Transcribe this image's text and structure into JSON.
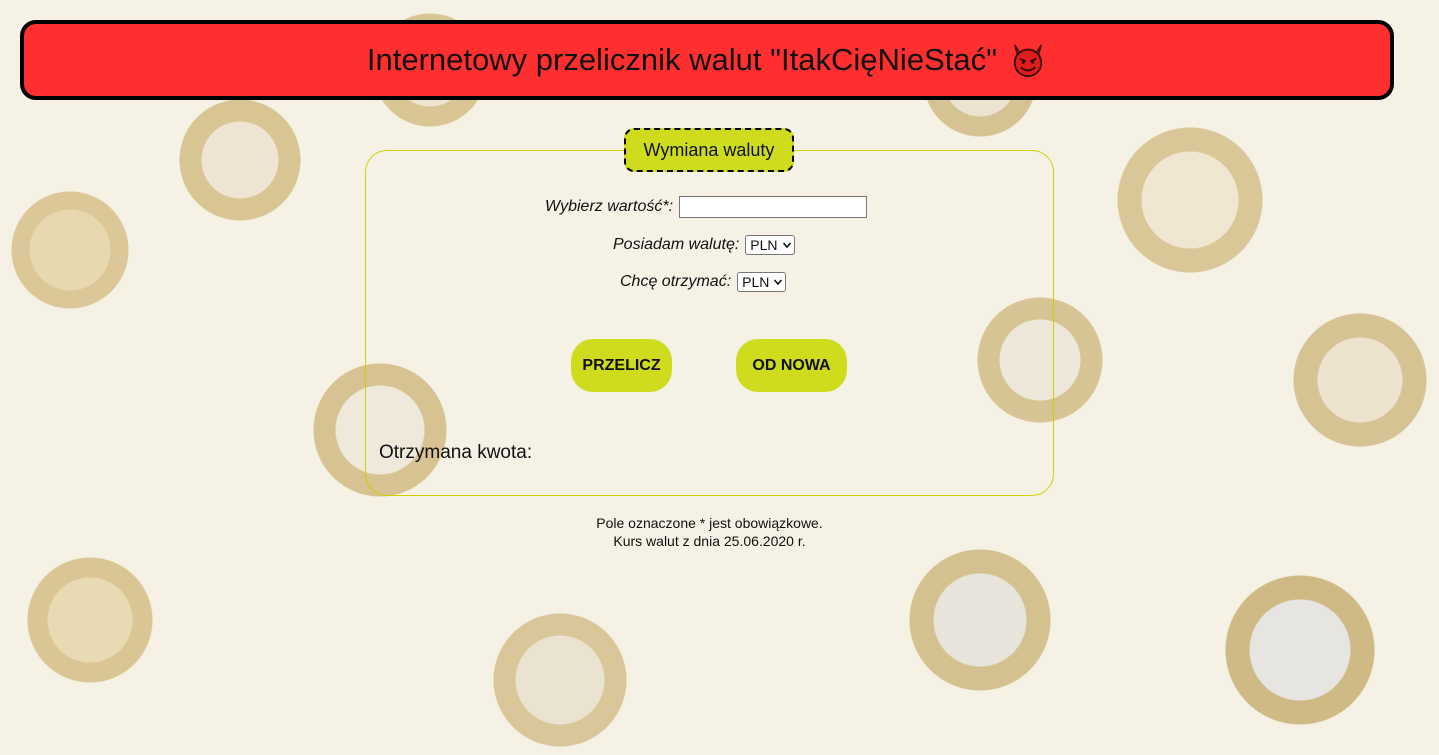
{
  "header": {
    "title": "Internetowy przelicznik walut \"ItakCięNieStać\"",
    "icon": "devil-emoji-icon"
  },
  "form": {
    "legend": "Wymiana waluty",
    "value_label": "Wybierz wartość*:",
    "value_input": "",
    "have_label": "Posiadam walutę:",
    "have_selected": "PLN",
    "want_label": "Chcę otrzymać:",
    "want_selected": "PLN",
    "calc_button": "PRZELICZ",
    "reset_button": "OD NOWA",
    "result_label": "Otrzymana kwota:"
  },
  "footer": {
    "line1": "Pole oznaczone * jest obowiązkowe.",
    "line2": "Kurs walut z dnia 25.06.2020 r."
  },
  "colors": {
    "header_bg": "#ff2f2f",
    "accent": "#cfdc1e",
    "fieldset_border": "#cfd100"
  }
}
